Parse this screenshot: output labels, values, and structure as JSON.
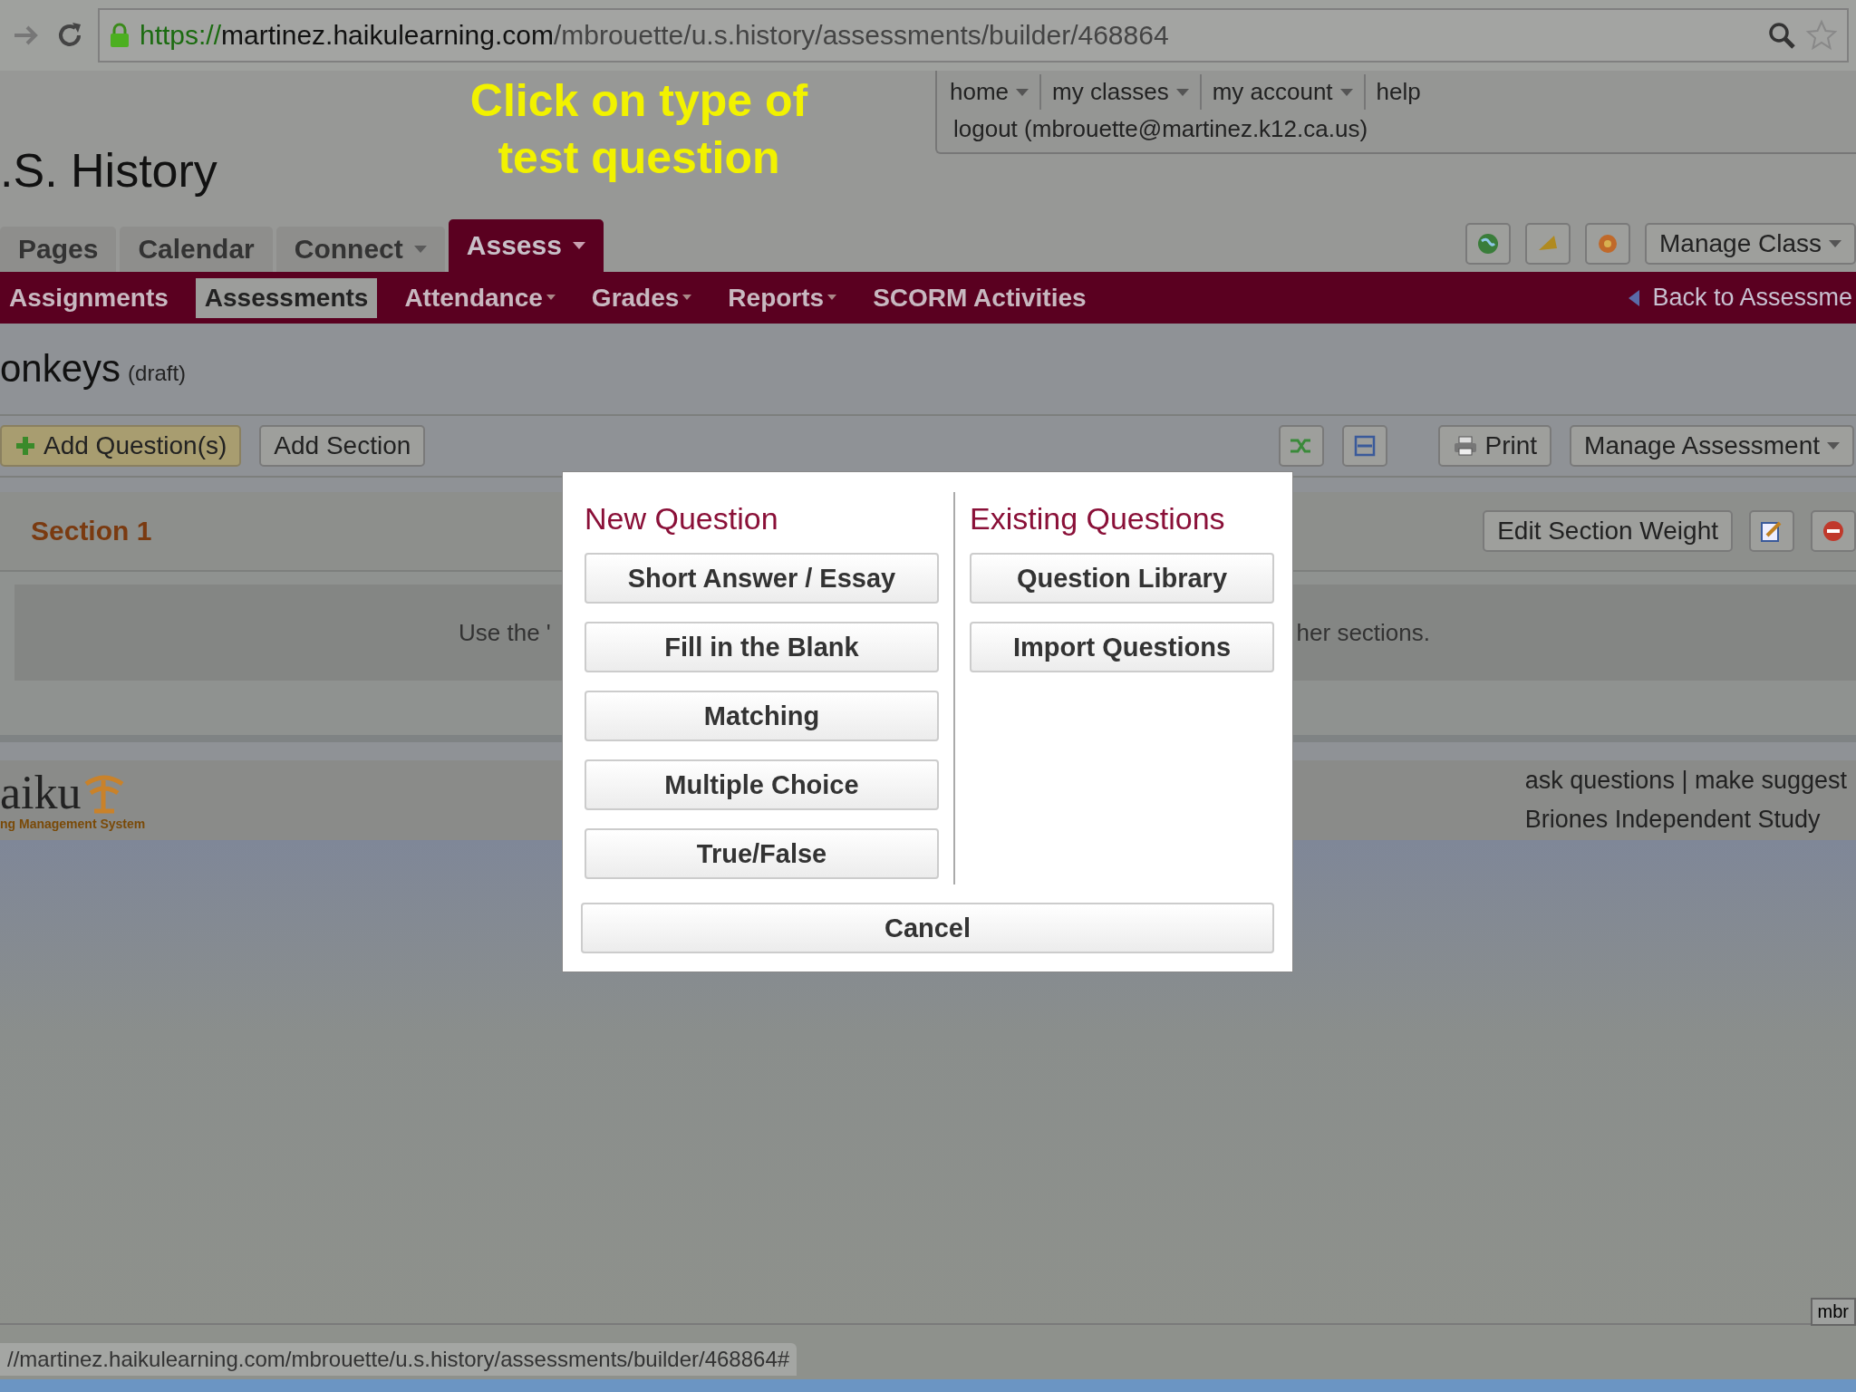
{
  "browser": {
    "url_scheme": "https://",
    "url_host": "martinez.haikulearning.com",
    "url_path": "/mbrouette/u.s.history/assessments/builder/468864"
  },
  "annotation": "Click on type of test question",
  "top_links": [
    {
      "label": "home",
      "dropdown": true
    },
    {
      "label": "my classes",
      "dropdown": true
    },
    {
      "label": "my account",
      "dropdown": true
    },
    {
      "label": "help",
      "dropdown": false
    }
  ],
  "logout": "logout (mbrouette@martinez.k12.ca.us)",
  "class_title": ".S. History",
  "tabs": [
    {
      "label": "Pages",
      "selected": false,
      "dropdown": false
    },
    {
      "label": "Calendar",
      "selected": false,
      "dropdown": false
    },
    {
      "label": "Connect",
      "selected": false,
      "dropdown": true
    },
    {
      "label": "Assess",
      "selected": true,
      "dropdown": true
    }
  ],
  "manage_class": "Manage Class",
  "subnav": [
    {
      "label": "Assignments",
      "selected": false,
      "dropdown": false
    },
    {
      "label": "Assessments",
      "selected": true,
      "dropdown": false
    },
    {
      "label": "Attendance",
      "selected": false,
      "dropdown": true
    },
    {
      "label": "Grades",
      "selected": false,
      "dropdown": true
    },
    {
      "label": "Reports",
      "selected": false,
      "dropdown": true
    },
    {
      "label": "SCORM Activities",
      "selected": false,
      "dropdown": false
    }
  ],
  "back_link": "Back to Assessme",
  "assessment": {
    "title": "onkeys",
    "status": "(draft)"
  },
  "toolbar": {
    "add_questions": "Add Question(s)",
    "add_section": "Add Section",
    "print": "Print",
    "manage": "Manage Assessment"
  },
  "section": {
    "title": "Section 1",
    "edit_weight": "Edit Section Weight",
    "hint_left": "Use the '",
    "hint_right": "her sections."
  },
  "footer": {
    "logo": "aiku",
    "logo_sub": "ng Management System",
    "links": "ask questions | make suggest",
    "school": "Briones Independent Study"
  },
  "dialog": {
    "new_heading": "New Question",
    "new_options": [
      "Short Answer / Essay",
      "Fill in the Blank",
      "Matching",
      "Multiple Choice",
      "True/False"
    ],
    "existing_heading": "Existing Questions",
    "existing_options": [
      "Question Library",
      "Import Questions"
    ],
    "cancel": "Cancel"
  },
  "status_url": "//martinez.haikulearning.com/mbrouette/u.s.history/assessments/builder/468864#",
  "corner_tab": "mbr"
}
